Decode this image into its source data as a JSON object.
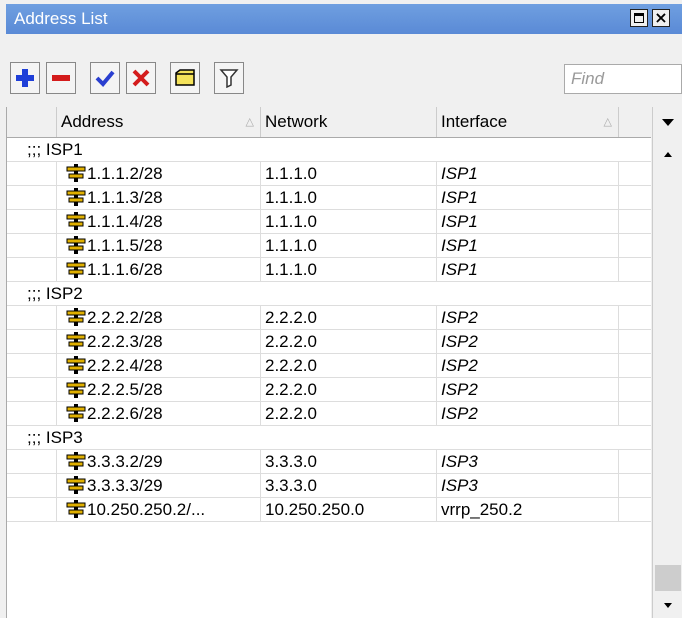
{
  "window": {
    "title": "Address List"
  },
  "toolbar": {
    "find_placeholder": "Find"
  },
  "columns": [
    "Address",
    "Network",
    "Interface"
  ],
  "groups": [
    {
      "label": ";;; ISP1",
      "rows": [
        {
          "address": "1.1.1.2/28",
          "network": "1.1.1.0",
          "interface": "ISP1"
        },
        {
          "address": "1.1.1.3/28",
          "network": "1.1.1.0",
          "interface": "ISP1"
        },
        {
          "address": "1.1.1.4/28",
          "network": "1.1.1.0",
          "interface": "ISP1"
        },
        {
          "address": "1.1.1.5/28",
          "network": "1.1.1.0",
          "interface": "ISP1"
        },
        {
          "address": "1.1.1.6/28",
          "network": "1.1.1.0",
          "interface": "ISP1"
        }
      ]
    },
    {
      "label": ";;; ISP2",
      "rows": [
        {
          "address": "2.2.2.2/28",
          "network": "2.2.2.0",
          "interface": "ISP2"
        },
        {
          "address": "2.2.2.3/28",
          "network": "2.2.2.0",
          "interface": "ISP2"
        },
        {
          "address": "2.2.2.4/28",
          "network": "2.2.2.0",
          "interface": "ISP2"
        },
        {
          "address": "2.2.2.5/28",
          "network": "2.2.2.0",
          "interface": "ISP2"
        },
        {
          "address": "2.2.2.6/28",
          "network": "2.2.2.0",
          "interface": "ISP2"
        }
      ]
    },
    {
      "label": ";;; ISP3",
      "rows": [
        {
          "address": "3.3.3.2/29",
          "network": "3.3.3.0",
          "interface": "ISP3"
        },
        {
          "address": "3.3.3.3/29",
          "network": "3.3.3.0",
          "interface": "ISP3"
        },
        {
          "address": "10.250.250.2/...",
          "network": "10.250.250.0",
          "interface": "vrrp_250.2",
          "interface_italic": false
        }
      ]
    }
  ],
  "icons": {
    "add": "plus-icon",
    "remove": "minus-icon",
    "enable": "check-icon",
    "disable": "x-icon",
    "comment": "note-icon",
    "filter": "filter-icon",
    "address": "address-icon"
  },
  "colors": {
    "title_bar": "#5a8ad6",
    "add": "#1f3fd8",
    "remove": "#d41c1c",
    "check": "#2a3fd0",
    "address_icon": "#e0b000"
  }
}
